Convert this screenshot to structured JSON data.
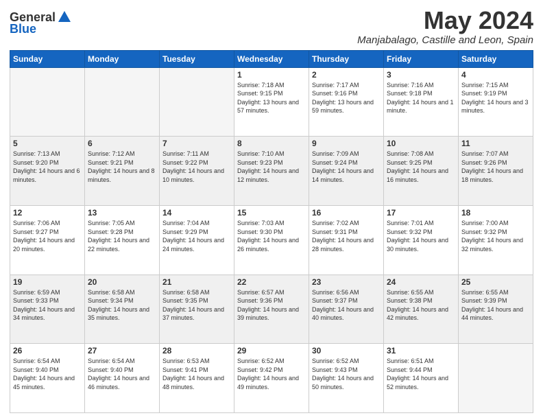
{
  "header": {
    "logo_general": "General",
    "logo_blue": "Blue",
    "month_title": "May 2024",
    "location": "Manjabalago, Castille and Leon, Spain"
  },
  "days_of_week": [
    "Sunday",
    "Monday",
    "Tuesday",
    "Wednesday",
    "Thursday",
    "Friday",
    "Saturday"
  ],
  "weeks": [
    {
      "alt": false,
      "days": [
        {
          "num": "",
          "empty": true,
          "text": ""
        },
        {
          "num": "",
          "empty": true,
          "text": ""
        },
        {
          "num": "",
          "empty": true,
          "text": ""
        },
        {
          "num": "1",
          "empty": false,
          "text": "Sunrise: 7:18 AM\nSunset: 9:15 PM\nDaylight: 13 hours and 57 minutes."
        },
        {
          "num": "2",
          "empty": false,
          "text": "Sunrise: 7:17 AM\nSunset: 9:16 PM\nDaylight: 13 hours and 59 minutes."
        },
        {
          "num": "3",
          "empty": false,
          "text": "Sunrise: 7:16 AM\nSunset: 9:18 PM\nDaylight: 14 hours and 1 minute."
        },
        {
          "num": "4",
          "empty": false,
          "text": "Sunrise: 7:15 AM\nSunset: 9:19 PM\nDaylight: 14 hours and 3 minutes."
        }
      ]
    },
    {
      "alt": true,
      "days": [
        {
          "num": "5",
          "empty": false,
          "text": "Sunrise: 7:13 AM\nSunset: 9:20 PM\nDaylight: 14 hours and 6 minutes."
        },
        {
          "num": "6",
          "empty": false,
          "text": "Sunrise: 7:12 AM\nSunset: 9:21 PM\nDaylight: 14 hours and 8 minutes."
        },
        {
          "num": "7",
          "empty": false,
          "text": "Sunrise: 7:11 AM\nSunset: 9:22 PM\nDaylight: 14 hours and 10 minutes."
        },
        {
          "num": "8",
          "empty": false,
          "text": "Sunrise: 7:10 AM\nSunset: 9:23 PM\nDaylight: 14 hours and 12 minutes."
        },
        {
          "num": "9",
          "empty": false,
          "text": "Sunrise: 7:09 AM\nSunset: 9:24 PM\nDaylight: 14 hours and 14 minutes."
        },
        {
          "num": "10",
          "empty": false,
          "text": "Sunrise: 7:08 AM\nSunset: 9:25 PM\nDaylight: 14 hours and 16 minutes."
        },
        {
          "num": "11",
          "empty": false,
          "text": "Sunrise: 7:07 AM\nSunset: 9:26 PM\nDaylight: 14 hours and 18 minutes."
        }
      ]
    },
    {
      "alt": false,
      "days": [
        {
          "num": "12",
          "empty": false,
          "text": "Sunrise: 7:06 AM\nSunset: 9:27 PM\nDaylight: 14 hours and 20 minutes."
        },
        {
          "num": "13",
          "empty": false,
          "text": "Sunrise: 7:05 AM\nSunset: 9:28 PM\nDaylight: 14 hours and 22 minutes."
        },
        {
          "num": "14",
          "empty": false,
          "text": "Sunrise: 7:04 AM\nSunset: 9:29 PM\nDaylight: 14 hours and 24 minutes."
        },
        {
          "num": "15",
          "empty": false,
          "text": "Sunrise: 7:03 AM\nSunset: 9:30 PM\nDaylight: 14 hours and 26 minutes."
        },
        {
          "num": "16",
          "empty": false,
          "text": "Sunrise: 7:02 AM\nSunset: 9:31 PM\nDaylight: 14 hours and 28 minutes."
        },
        {
          "num": "17",
          "empty": false,
          "text": "Sunrise: 7:01 AM\nSunset: 9:32 PM\nDaylight: 14 hours and 30 minutes."
        },
        {
          "num": "18",
          "empty": false,
          "text": "Sunrise: 7:00 AM\nSunset: 9:32 PM\nDaylight: 14 hours and 32 minutes."
        }
      ]
    },
    {
      "alt": true,
      "days": [
        {
          "num": "19",
          "empty": false,
          "text": "Sunrise: 6:59 AM\nSunset: 9:33 PM\nDaylight: 14 hours and 34 minutes."
        },
        {
          "num": "20",
          "empty": false,
          "text": "Sunrise: 6:58 AM\nSunset: 9:34 PM\nDaylight: 14 hours and 35 minutes."
        },
        {
          "num": "21",
          "empty": false,
          "text": "Sunrise: 6:58 AM\nSunset: 9:35 PM\nDaylight: 14 hours and 37 minutes."
        },
        {
          "num": "22",
          "empty": false,
          "text": "Sunrise: 6:57 AM\nSunset: 9:36 PM\nDaylight: 14 hours and 39 minutes."
        },
        {
          "num": "23",
          "empty": false,
          "text": "Sunrise: 6:56 AM\nSunset: 9:37 PM\nDaylight: 14 hours and 40 minutes."
        },
        {
          "num": "24",
          "empty": false,
          "text": "Sunrise: 6:55 AM\nSunset: 9:38 PM\nDaylight: 14 hours and 42 minutes."
        },
        {
          "num": "25",
          "empty": false,
          "text": "Sunrise: 6:55 AM\nSunset: 9:39 PM\nDaylight: 14 hours and 44 minutes."
        }
      ]
    },
    {
      "alt": false,
      "days": [
        {
          "num": "26",
          "empty": false,
          "text": "Sunrise: 6:54 AM\nSunset: 9:40 PM\nDaylight: 14 hours and 45 minutes."
        },
        {
          "num": "27",
          "empty": false,
          "text": "Sunrise: 6:54 AM\nSunset: 9:40 PM\nDaylight: 14 hours and 46 minutes."
        },
        {
          "num": "28",
          "empty": false,
          "text": "Sunrise: 6:53 AM\nSunset: 9:41 PM\nDaylight: 14 hours and 48 minutes."
        },
        {
          "num": "29",
          "empty": false,
          "text": "Sunrise: 6:52 AM\nSunset: 9:42 PM\nDaylight: 14 hours and 49 minutes."
        },
        {
          "num": "30",
          "empty": false,
          "text": "Sunrise: 6:52 AM\nSunset: 9:43 PM\nDaylight: 14 hours and 50 minutes."
        },
        {
          "num": "31",
          "empty": false,
          "text": "Sunrise: 6:51 AM\nSunset: 9:44 PM\nDaylight: 14 hours and 52 minutes."
        },
        {
          "num": "",
          "empty": true,
          "text": ""
        }
      ]
    }
  ]
}
